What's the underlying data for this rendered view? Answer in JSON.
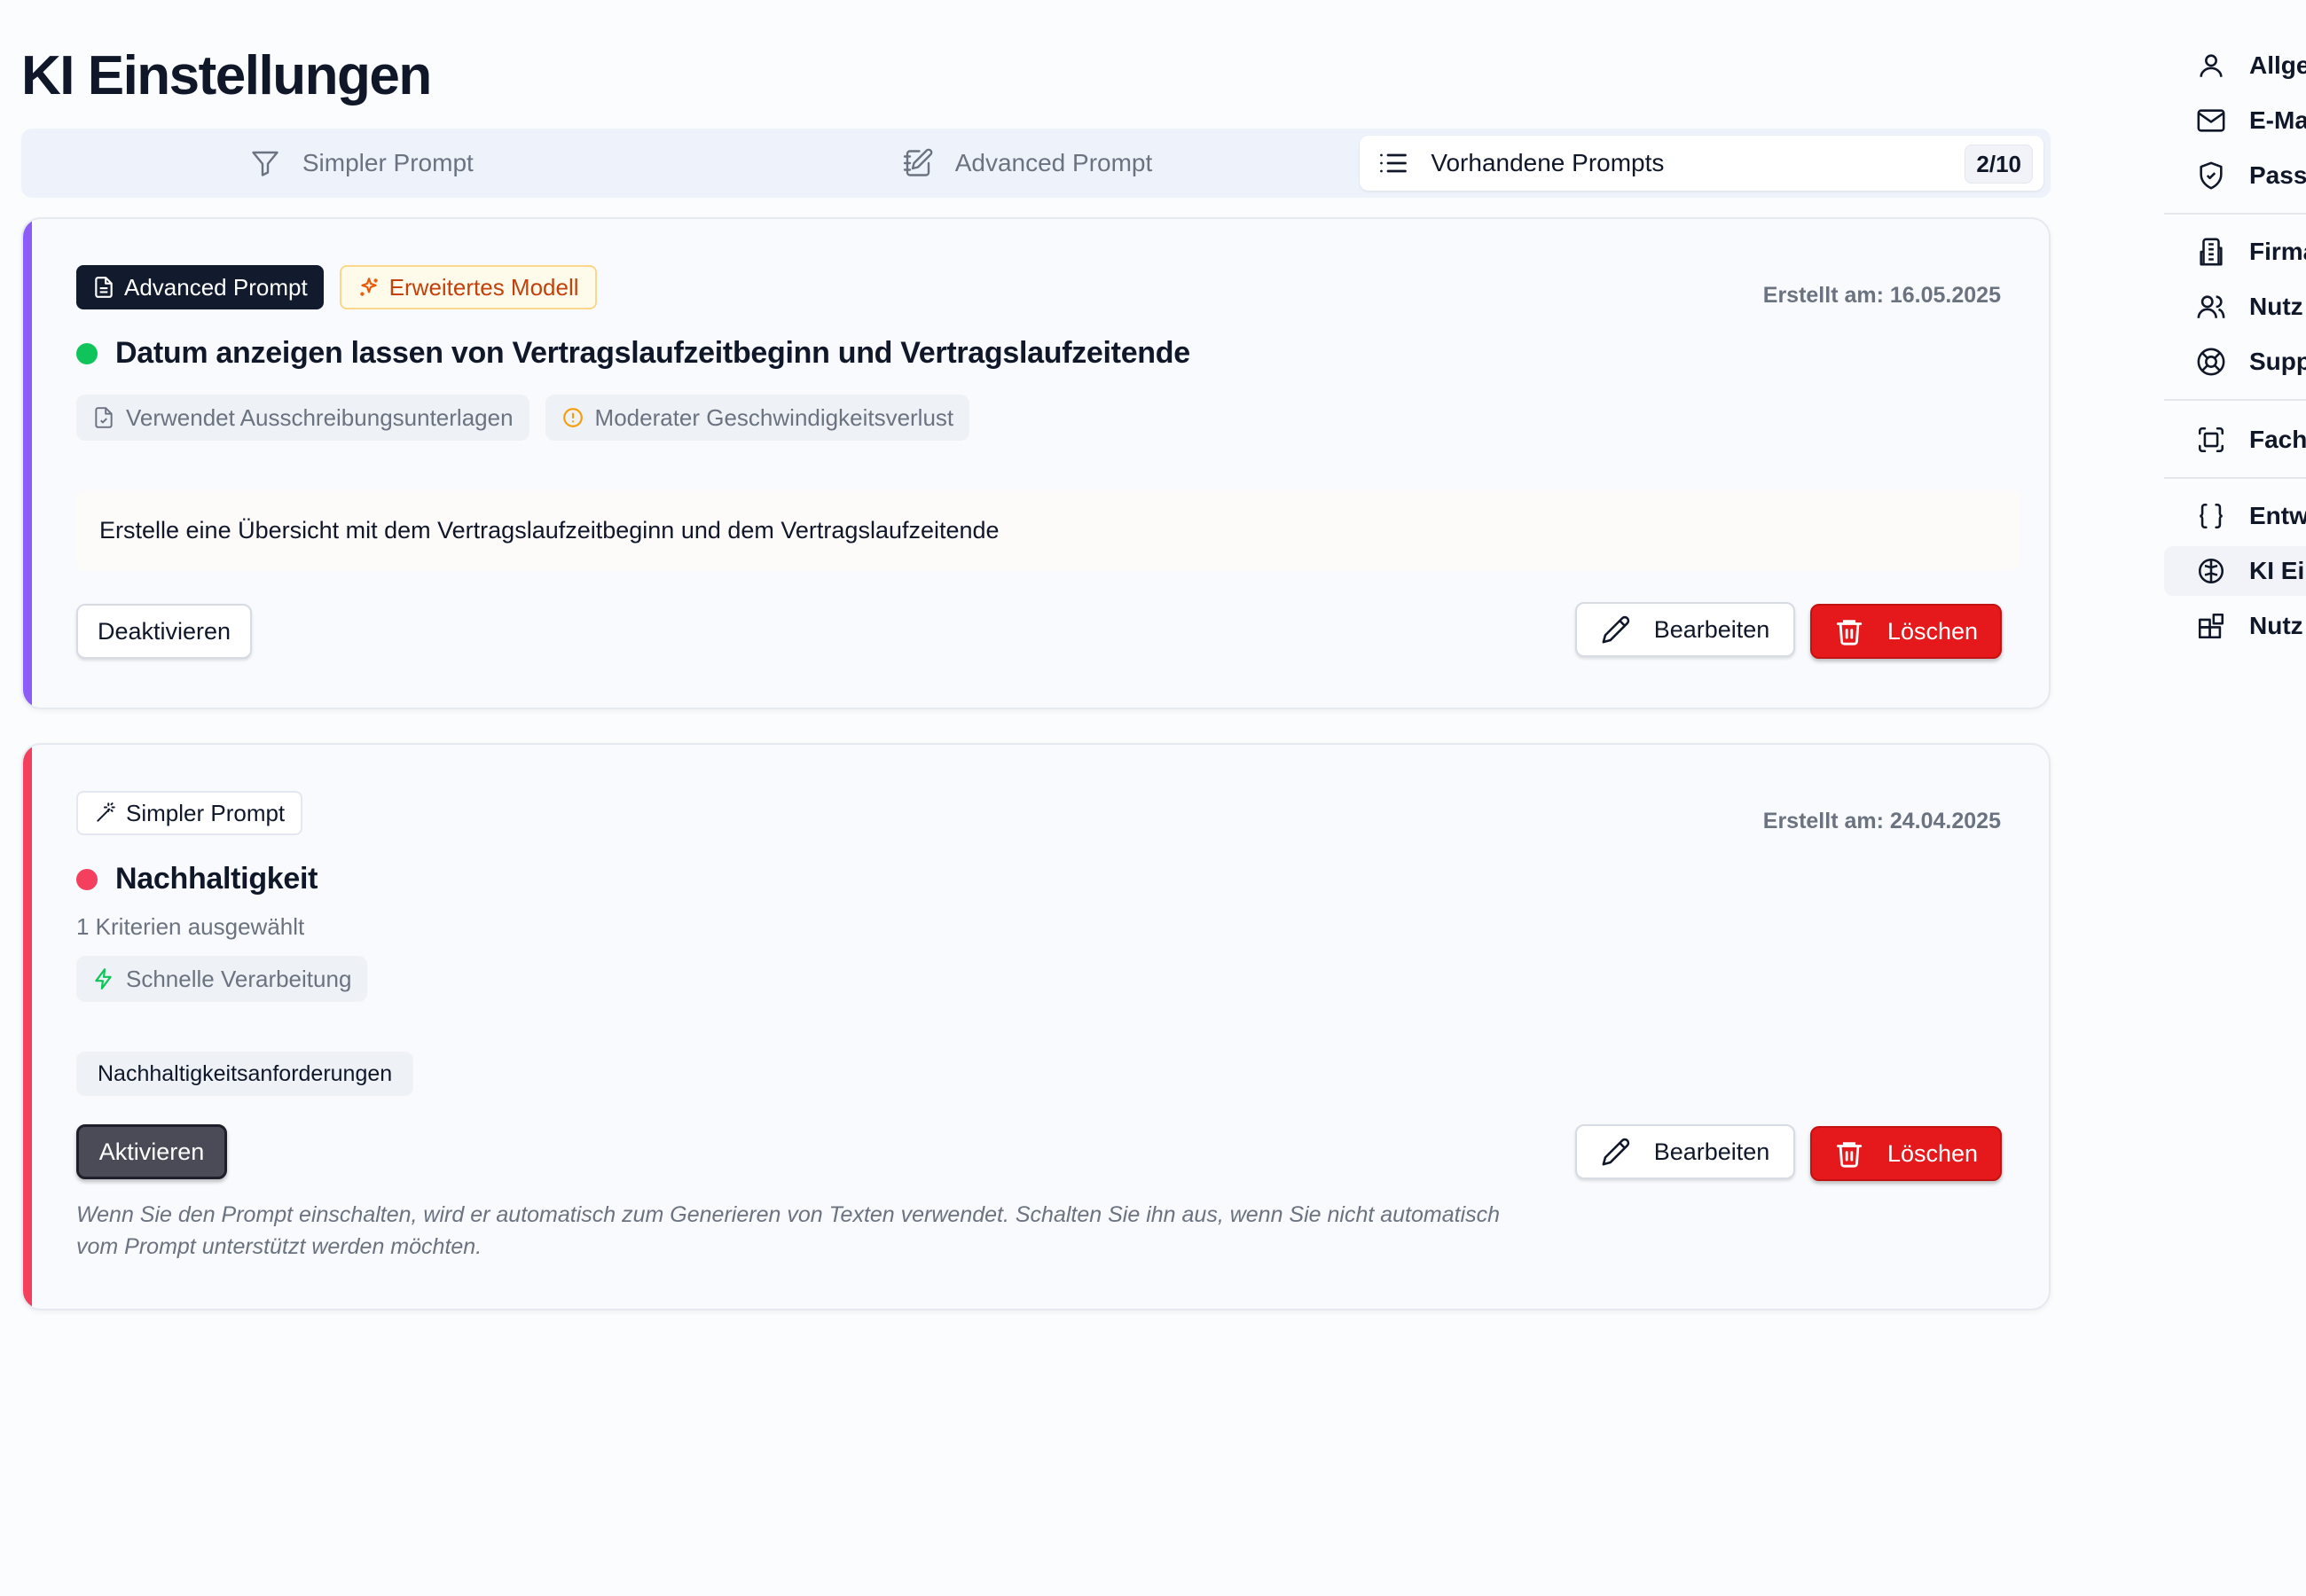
{
  "page": {
    "title": "KI Einstellungen"
  },
  "tabs": [
    {
      "label": "Simpler Prompt",
      "icon": "filter-icon"
    },
    {
      "label": "Advanced Prompt",
      "icon": "notebook-pen-icon"
    },
    {
      "label": "Vorhandene Prompts",
      "icon": "list-icon",
      "count": "2/10",
      "active": true
    }
  ],
  "prompts": [
    {
      "type_badge": "Advanced Prompt",
      "model_badge": "Erweitertes Modell",
      "created": "Erstellt am: 16.05.2025",
      "title": "Datum anzeigen lassen von Vertragslaufzeitbeginn und Vertragslaufzeitende",
      "status": "active",
      "status_color": "#10c45c",
      "accent_color": "#8b5cf6",
      "chips": [
        "Verwendet Ausschreibungsunterlagen",
        "Moderater Geschwindigkeitsverlust"
      ],
      "description": "Erstelle eine Übersicht mit dem Vertragslaufzeitbeginn und dem Vertragslaufzeitende",
      "toggle_label": "Deaktivieren",
      "edit_label": "Bearbeiten",
      "delete_label": "Löschen"
    },
    {
      "type_badge": "Simpler Prompt",
      "created": "Erstellt am: 24.04.2025",
      "title": "Nachhaltigkeit",
      "status": "inactive",
      "status_color": "#f43f5e",
      "accent_color": "#f43f5e",
      "criteria": "1 Kriterien ausgewählt",
      "chips": [
        "Schnelle Verarbeitung"
      ],
      "tags": [
        "Nachhaltigkeitsanforderungen"
      ],
      "toggle_label": "Aktivieren",
      "edit_label": "Bearbeiten",
      "delete_label": "Löschen",
      "note": "Wenn Sie den Prompt einschalten, wird er automatisch zum Generieren von Texten verwendet. Schalten Sie ihn aus, wenn Sie nicht automatisch vom Prompt unterstützt werden möchten."
    }
  ],
  "sidebar": {
    "items": [
      {
        "label": "Allge",
        "icon": "user-icon"
      },
      {
        "label": "E-Ma",
        "icon": "mail-icon"
      },
      {
        "label": "Passw",
        "icon": "shield-icon"
      },
      {
        "label": "Firma",
        "icon": "building-icon"
      },
      {
        "label": "Nutz",
        "icon": "users-icon"
      },
      {
        "label": "Supp",
        "icon": "life-buoy-icon"
      },
      {
        "label": "Fach",
        "icon": "scan-icon"
      },
      {
        "label": "Entw",
        "icon": "braces-icon"
      },
      {
        "label": "KI Ei",
        "icon": "brain-icon",
        "active": true
      },
      {
        "label": "Nutz",
        "icon": "blocks-icon"
      }
    ]
  }
}
